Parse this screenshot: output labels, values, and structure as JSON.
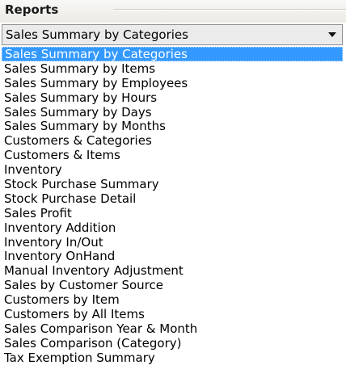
{
  "header": {
    "title": "Reports"
  },
  "dropdown": {
    "selected_value": "Sales Summary by Categories",
    "arrow_icon": "chevron-down-icon",
    "accent_color": "#3399ff",
    "options": [
      "Sales Summary by Categories",
      "Sales Summary by Items",
      "Sales Summary by Employees",
      "Sales Summary by Hours",
      "Sales Summary by Days",
      "Sales Summary by Months",
      "Customers & Categories",
      "Customers & Items",
      "Inventory",
      "Stock Purchase Summary",
      "Stock Purchase Detail",
      "Sales Profit",
      "Inventory Addition",
      "Inventory In/Out",
      "Inventory OnHand",
      "Manual Inventory Adjustment",
      "Sales by Customer Source",
      "Customers by Item",
      "Customers by All Items",
      "Sales Comparison Year & Month",
      "Sales Comparison (Category)",
      "Tax Exemption Summary"
    ]
  }
}
